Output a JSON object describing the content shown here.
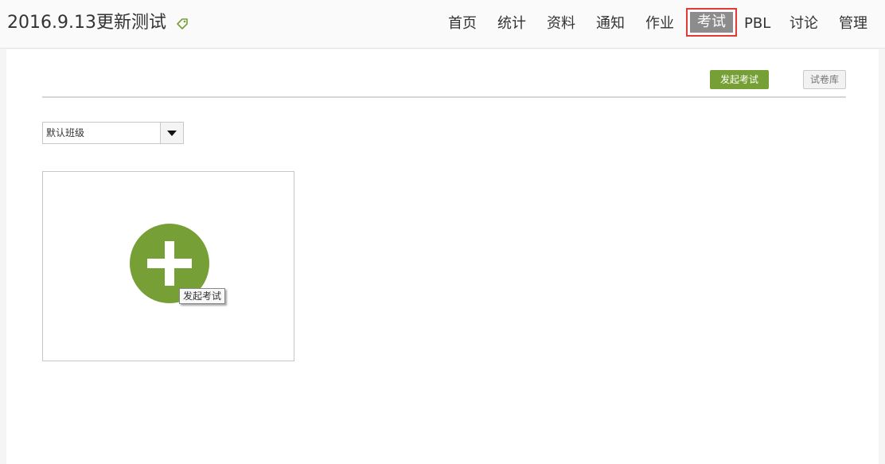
{
  "header": {
    "course_title": "2016.9.13更新测试",
    "tag_icon": "tag-icon"
  },
  "nav": {
    "items": [
      {
        "label": "首页"
      },
      {
        "label": "统计"
      },
      {
        "label": "资料"
      },
      {
        "label": "通知"
      },
      {
        "label": "作业"
      },
      {
        "label": "考试",
        "active": true
      },
      {
        "label": "PBL"
      },
      {
        "label": "讨论"
      },
      {
        "label": "管理"
      }
    ]
  },
  "toolbar": {
    "start_exam_label": "发起考试",
    "exam_library_label": "试卷库"
  },
  "class_select": {
    "selected": "默认班级"
  },
  "card": {
    "add_icon": "plus-circle-icon",
    "tooltip": "发起考试"
  },
  "colors": {
    "accent_green": "#76a035",
    "active_tab_bg": "#8c8c8c",
    "highlight_border": "#e03b3b"
  }
}
